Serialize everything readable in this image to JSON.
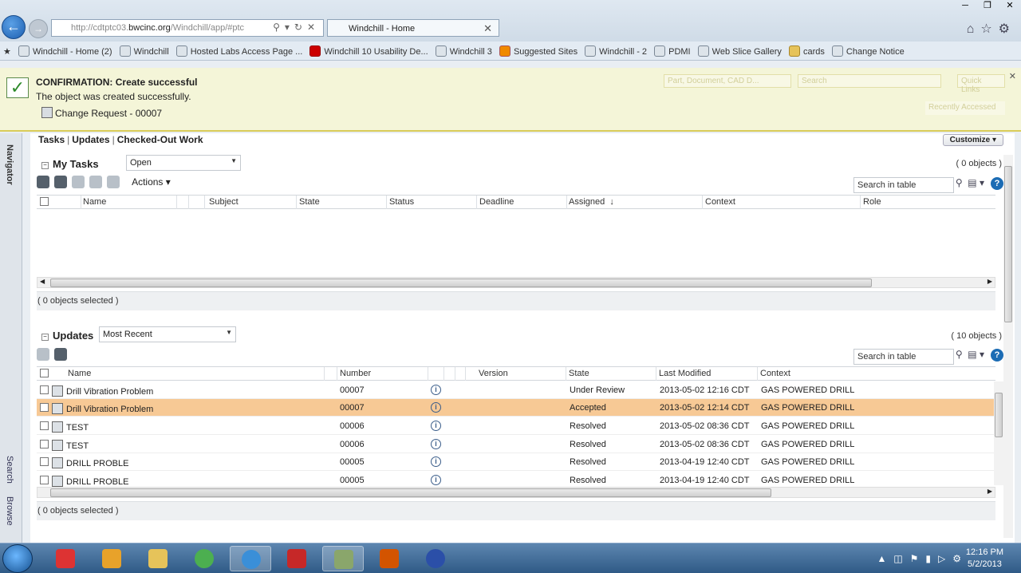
{
  "browser": {
    "address": {
      "prefix": "http://cdtptc03.",
      "domain": "bwcinc.org",
      "suffix": "/Windchill/app/#ptc"
    },
    "tab_title": "Windchill - Home",
    "favorites": [
      {
        "label": "Windchill - Home (2)"
      },
      {
        "label": "Windchill"
      },
      {
        "label": "Hosted Labs Access Page ..."
      },
      {
        "label": "Windchill 10 Usability De..."
      },
      {
        "label": "Windchill 3"
      },
      {
        "label": "Suggested Sites"
      },
      {
        "label": "Windchill - 2"
      },
      {
        "label": "PDMI"
      },
      {
        "label": "Web Slice Gallery"
      },
      {
        "label": "cards"
      },
      {
        "label": "Change Notice"
      }
    ]
  },
  "confirmation": {
    "title": "CONFIRMATION: Create successful",
    "message": "The object was created successfully.",
    "object": "Change Request - 00007",
    "ghost_type": "Part, Document, CAD D...",
    "ghost_search": "Search",
    "ghost_quick": "Quick Links",
    "ghost_recent": "Recently Accessed"
  },
  "navigator": {
    "label": "Navigator",
    "search": "Search",
    "browse": "Browse"
  },
  "main": {
    "links": [
      "Tasks",
      "Updates",
      "Checked-Out Work"
    ],
    "customize": "Customize"
  },
  "my_tasks": {
    "title": "My Tasks",
    "filter": "Open",
    "count": "( 0 objects )",
    "actions": "Actions",
    "search_placeholder": "Search in table",
    "columns": [
      "Name",
      "Subject",
      "State",
      "Status",
      "Deadline",
      "Assigned",
      "Context",
      "Role"
    ],
    "sort_indicator": "↓",
    "selected": "( 0 objects selected )"
  },
  "updates": {
    "title": "Updates",
    "filter": "Most Recent",
    "count": "( 10 objects )",
    "search_placeholder": "Search in table",
    "columns": [
      "Name",
      "Number",
      "Version",
      "State",
      "Last Modified",
      "Context"
    ],
    "rows": [
      {
        "name": "Drill Vibration Problem",
        "number": "00007",
        "state": "Under Review",
        "modified": "2013-05-02 12:16 CDT",
        "context": "GAS POWERED DRILL"
      },
      {
        "name": "Drill Vibration Problem",
        "number": "00007",
        "state": "Accepted",
        "modified": "2013-05-02 12:14 CDT",
        "context": "GAS POWERED DRILL"
      },
      {
        "name": "TEST",
        "number": "00006",
        "state": "Resolved",
        "modified": "2013-05-02 08:36 CDT",
        "context": "GAS POWERED DRILL"
      },
      {
        "name": "TEST",
        "number": "00006",
        "state": "Resolved",
        "modified": "2013-05-02 08:36 CDT",
        "context": "GAS POWERED DRILL"
      },
      {
        "name": "DRILL PROBLE",
        "number": "00005",
        "state": "Resolved",
        "modified": "2013-04-19 12:40 CDT",
        "context": "GAS POWERED DRILL"
      },
      {
        "name": "DRILL PROBLE",
        "number": "00005",
        "state": "Resolved",
        "modified": "2013-04-19 12:40 CDT",
        "context": "GAS POWERED DRILL"
      }
    ],
    "selected": "( 0 objects selected )"
  },
  "taskbar": {
    "time": "12:16 PM",
    "date": "5/2/2013"
  },
  "colors": {
    "highlight_row": "#f7c995",
    "confirm_bg": "#f4f5d8",
    "accent": "#1c6cb4"
  }
}
